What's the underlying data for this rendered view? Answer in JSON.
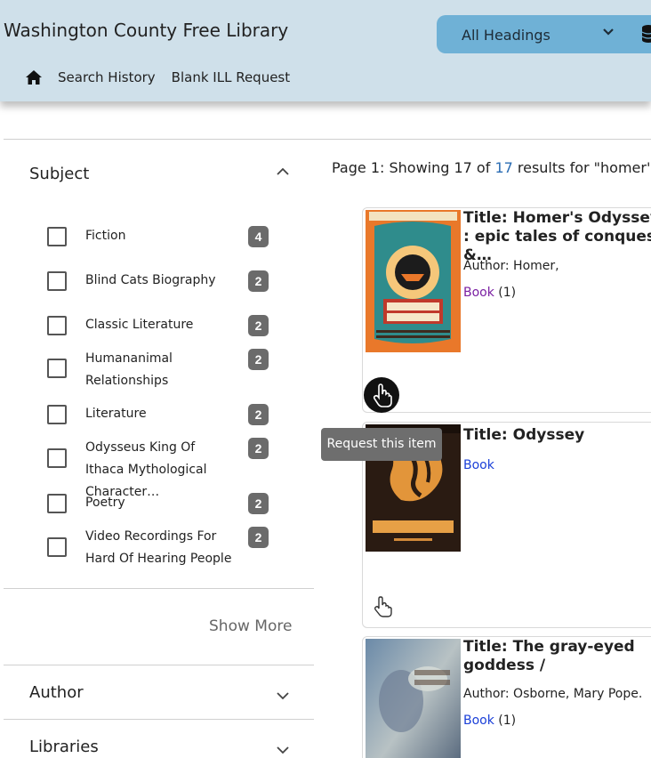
{
  "header": {
    "site_title": "Washington County Free Library",
    "heading_select": {
      "value": "All Headings"
    },
    "nav": {
      "search_history": "Search History",
      "blank_ill": "Blank ILL Request"
    }
  },
  "sidebar": {
    "subject": {
      "heading": "Subject",
      "items": [
        {
          "label": "Fiction",
          "count": "4"
        },
        {
          "label": "Blind Cats Biography",
          "count": "2"
        },
        {
          "label": "Classic Literature",
          "count": "2"
        },
        {
          "label": "Humananimal Relationships",
          "count": "2"
        },
        {
          "label": "Literature",
          "count": "2"
        },
        {
          "label": "Odysseus King Of Ithaca Mythological Character…",
          "count": "2"
        },
        {
          "label": "Poetry",
          "count": "2"
        },
        {
          "label": "Video Recordings For Hard Of Hearing People",
          "count": "2"
        }
      ],
      "show_more": "Show More"
    },
    "author": {
      "heading": "Author"
    },
    "libraries": {
      "heading": "Libraries"
    }
  },
  "results": {
    "summary_prefix": "Page 1: Showing 17 of ",
    "summary_total": "17",
    "summary_suffix": " results for \"homer's od",
    "items": [
      {
        "title": "Title: Homer's Odyssey : epic tales of conquest &…",
        "author": "Author: Homer,",
        "format": "Book",
        "format_count": "(1)"
      },
      {
        "title": "Title: Odyssey",
        "format": "Book"
      },
      {
        "title": "Title: The gray-eyed goddess /",
        "author": "Author: Osborne, Mary Pope.",
        "format": "Book",
        "format_count": "(1)"
      }
    ],
    "tooltip": "Request this item"
  },
  "colors": {
    "header_bg": "#cfe0ea",
    "select_bg": "#6fb1d6",
    "badge_bg": "#6b6b6b",
    "link_blue": "#1a3fd8",
    "link_purple": "#7a1fa2"
  }
}
